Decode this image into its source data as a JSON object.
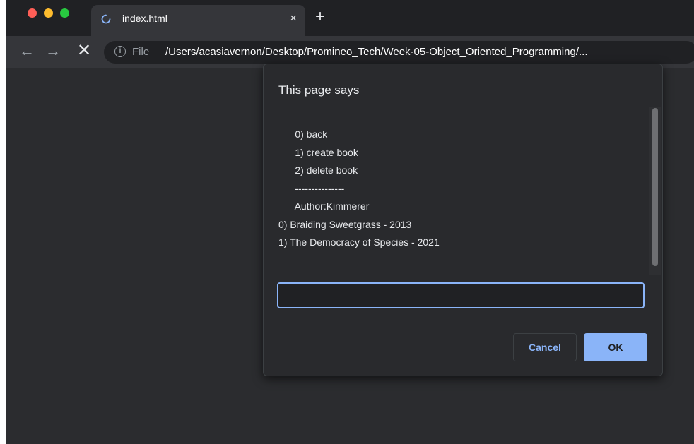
{
  "browser": {
    "tab": {
      "title": "index.html",
      "close_glyph": "×"
    },
    "new_tab_glyph": "+",
    "toolbar": {
      "back_glyph": "←",
      "forward_glyph": "→",
      "stop_glyph": "✕",
      "info_glyph": "i",
      "scheme_label": "File",
      "url": "/Users/acasiavernon/Desktop/Promineo_Tech/Week-05-Object_Oriented_Programming/..."
    }
  },
  "dialog": {
    "title": "This page says",
    "message": "      0) back\n      1) create book\n      2) delete book\n      ---------------\n      Author:Kimmerer\n0) Braiding Sweetgrass - 2013\n1) The Democracy of Species - 2021",
    "input_value": "",
    "cancel_label": "Cancel",
    "ok_label": "OK"
  },
  "colors": {
    "accent": "#8ab4f8",
    "dialog_bg": "#292a2d",
    "page_bg": "#2b2c2f"
  },
  "icons": {
    "tab_loading": "loading-spinner-icon",
    "back": "back-arrow-icon",
    "forward": "forward-arrow-icon",
    "stop": "stop-icon",
    "info": "info-icon"
  }
}
